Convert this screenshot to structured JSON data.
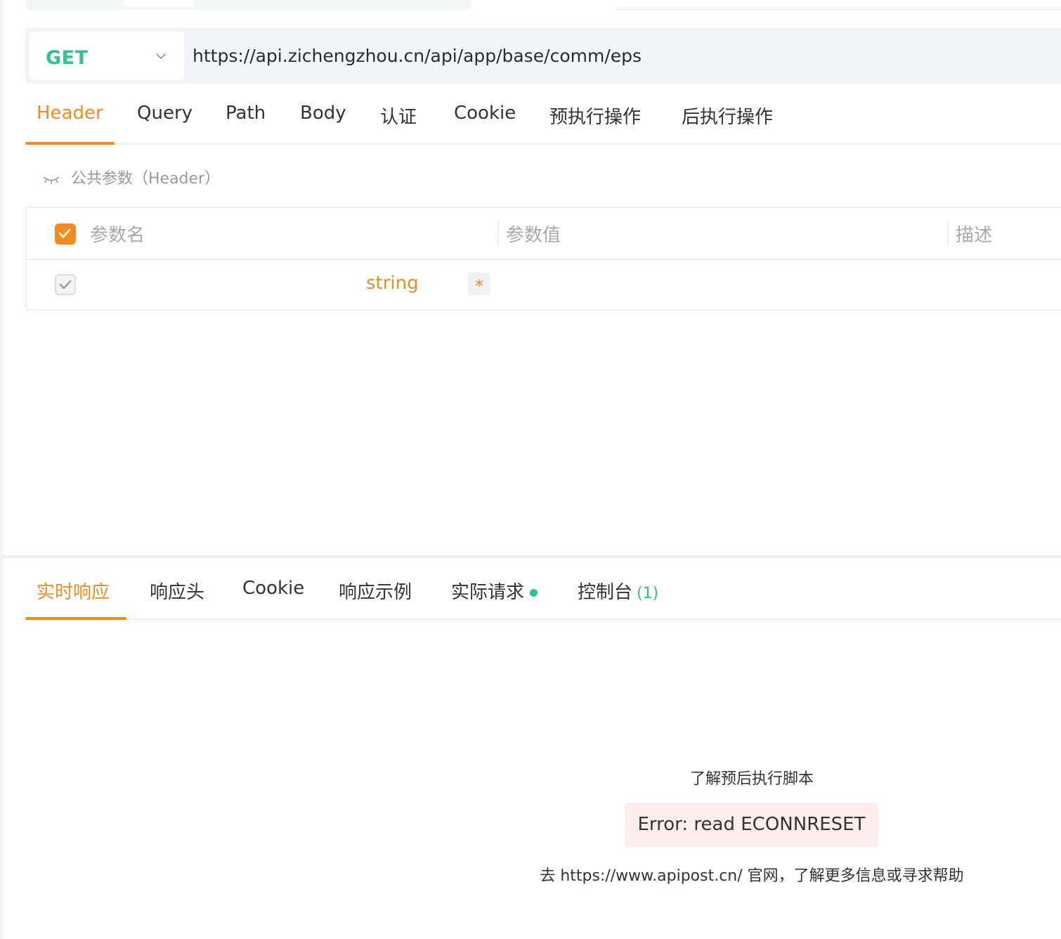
{
  "request": {
    "method": "GET",
    "url": "https://api.zichengzhou.cn/api/app/base/comm/eps"
  },
  "request_tabs": [
    {
      "label": "Header",
      "active": true
    },
    {
      "label": "Query",
      "active": false
    },
    {
      "label": "Path",
      "active": false
    },
    {
      "label": "Body",
      "active": false
    },
    {
      "label": "认证",
      "active": false
    },
    {
      "label": "Cookie",
      "active": false
    },
    {
      "label": "预执行操作",
      "active": false
    },
    {
      "label": "后执行操作",
      "active": false
    }
  ],
  "public_params": {
    "label": "公共参数（Header）",
    "icon": "eye-closed-icon"
  },
  "param_table": {
    "headers": {
      "name": "参数名",
      "value": "参数值",
      "description": "描述"
    },
    "header_checked": true,
    "rows": [
      {
        "checked": true,
        "name": "",
        "type": "string",
        "required_mark": "*",
        "value": "",
        "description": ""
      }
    ]
  },
  "response_tabs": [
    {
      "label": "实时响应",
      "active": true
    },
    {
      "label": "响应头",
      "active": false
    },
    {
      "label": "Cookie",
      "active": false
    },
    {
      "label": "响应示例",
      "active": false
    },
    {
      "label": "实际请求",
      "active": false,
      "status_dot": true
    },
    {
      "label": "控制台",
      "active": false,
      "count": "(1)"
    }
  ],
  "response": {
    "script_link": "了解预后执行脚本",
    "error": "Error: read ECONNRESET",
    "help": "去 https://www.apipost.cn/ 官网，了解更多信息或寻求帮助"
  },
  "colors": {
    "accent": "#f58a1f",
    "method_get": "#2bc48c",
    "status_dot": "#2bc48c",
    "error_bg": "#fdeeee"
  }
}
